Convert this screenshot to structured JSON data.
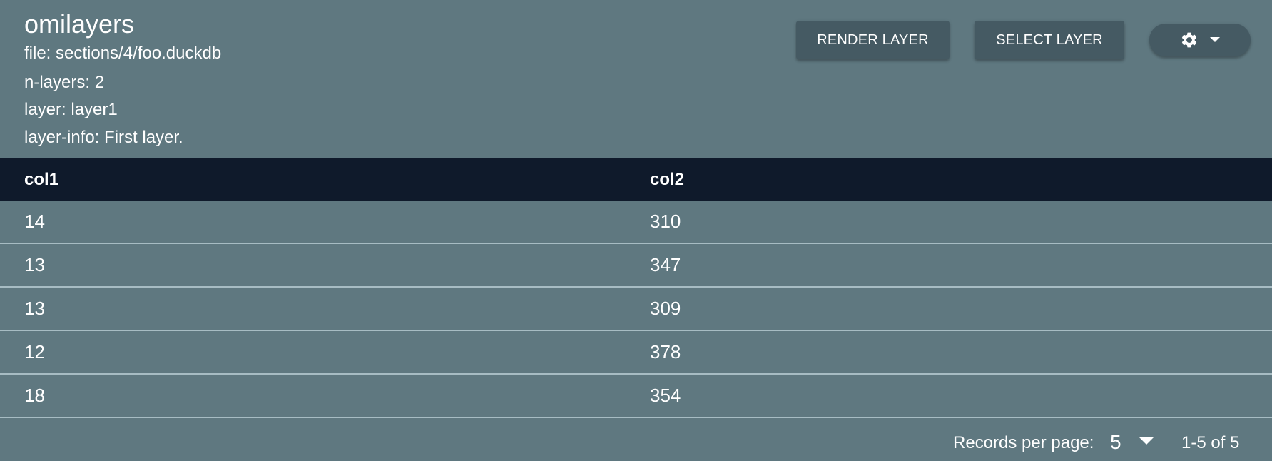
{
  "header": {
    "title": "omilayers",
    "file_line": "file: sections/4/foo.duckdb",
    "nlayers_line": "n-layers: 2",
    "layer_line": "layer: layer1",
    "layer_info_line": "layer-info: First layer."
  },
  "toolbar": {
    "render_label": "RENDER LAYER",
    "select_label": "SELECT LAYER",
    "settings_icon": "gear-icon",
    "dropdown_icon": "caret-down-icon"
  },
  "table": {
    "columns": [
      "col1",
      "col2"
    ],
    "rows": [
      [
        "14",
        "310"
      ],
      [
        "13",
        "347"
      ],
      [
        "13",
        "309"
      ],
      [
        "12",
        "378"
      ],
      [
        "18",
        "354"
      ]
    ]
  },
  "pagination": {
    "records_label": "Records per page:",
    "records_value": "5",
    "range_text": "1-5 of 5"
  },
  "colors": {
    "background": "#5f7880",
    "table_header": "#0f1a2b",
    "button": "#455a63",
    "row_divider": "#a7bcc3"
  }
}
